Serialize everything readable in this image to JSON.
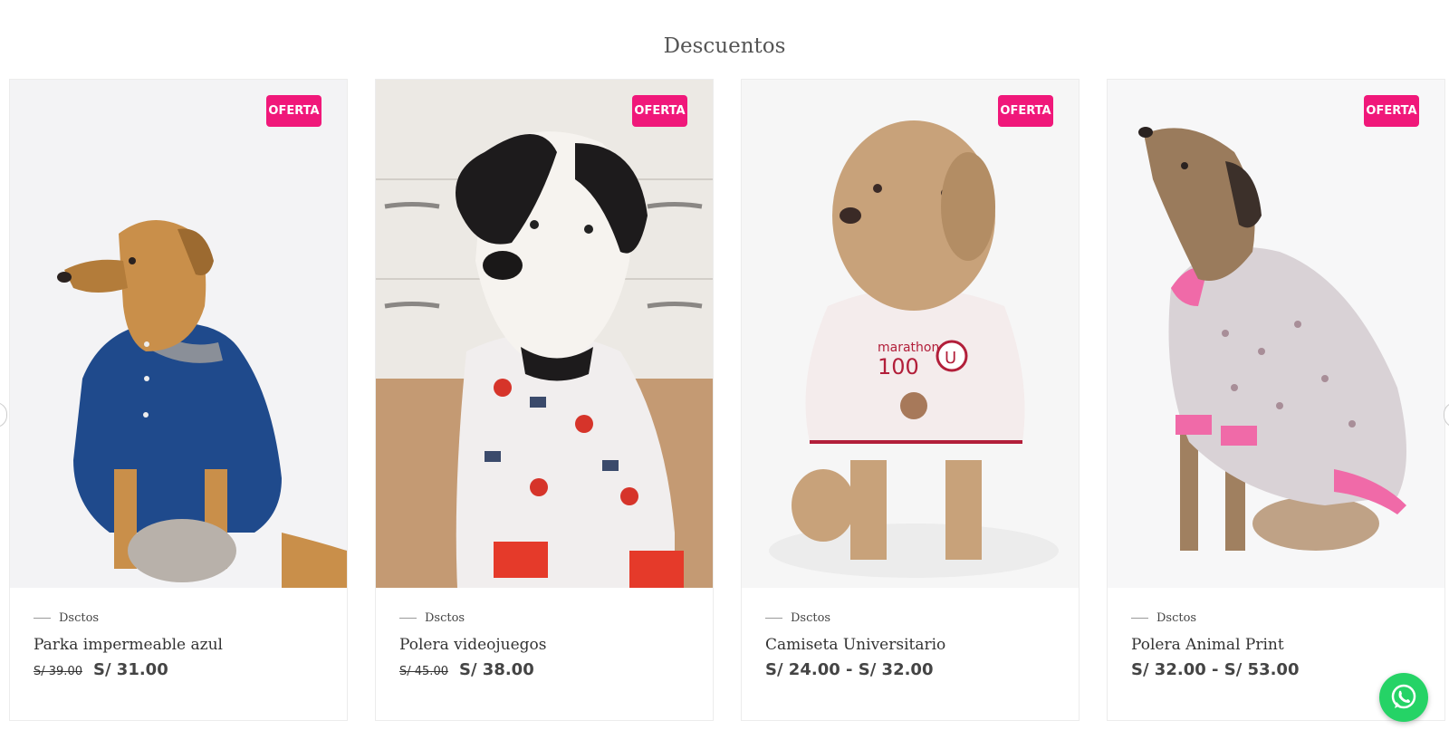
{
  "section": {
    "title": "Descuentos"
  },
  "colors": {
    "badge": "#f0187a",
    "whatsapp": "#25d366"
  },
  "products": [
    {
      "badge": "OFERTA",
      "category": "Dsctos",
      "name": "Parka impermeable azul",
      "old_price": "S/ 39.00",
      "price": "S/ 31.00",
      "image": "dog-blue-parka-photo"
    },
    {
      "badge": "OFERTA",
      "category": "Dsctos",
      "name": "Polera videojuegos",
      "old_price": "S/ 45.00",
      "price": "S/ 38.00",
      "image": "dog-gamer-hoodie-photo"
    },
    {
      "badge": "OFERTA",
      "category": "Dsctos",
      "name": "Camiseta Universitario",
      "old_price": "",
      "price": "S/ 24.00 - S/ 32.00",
      "image": "dog-white-shirt-photo"
    },
    {
      "badge": "OFERTA",
      "category": "Dsctos",
      "name": "Polera Animal Print",
      "old_price": "",
      "price": "S/ 32.00 - S/ 53.00",
      "image": "dog-leopard-hoodie-photo"
    }
  ],
  "floating": {
    "whatsapp_icon": "whatsapp-icon"
  }
}
